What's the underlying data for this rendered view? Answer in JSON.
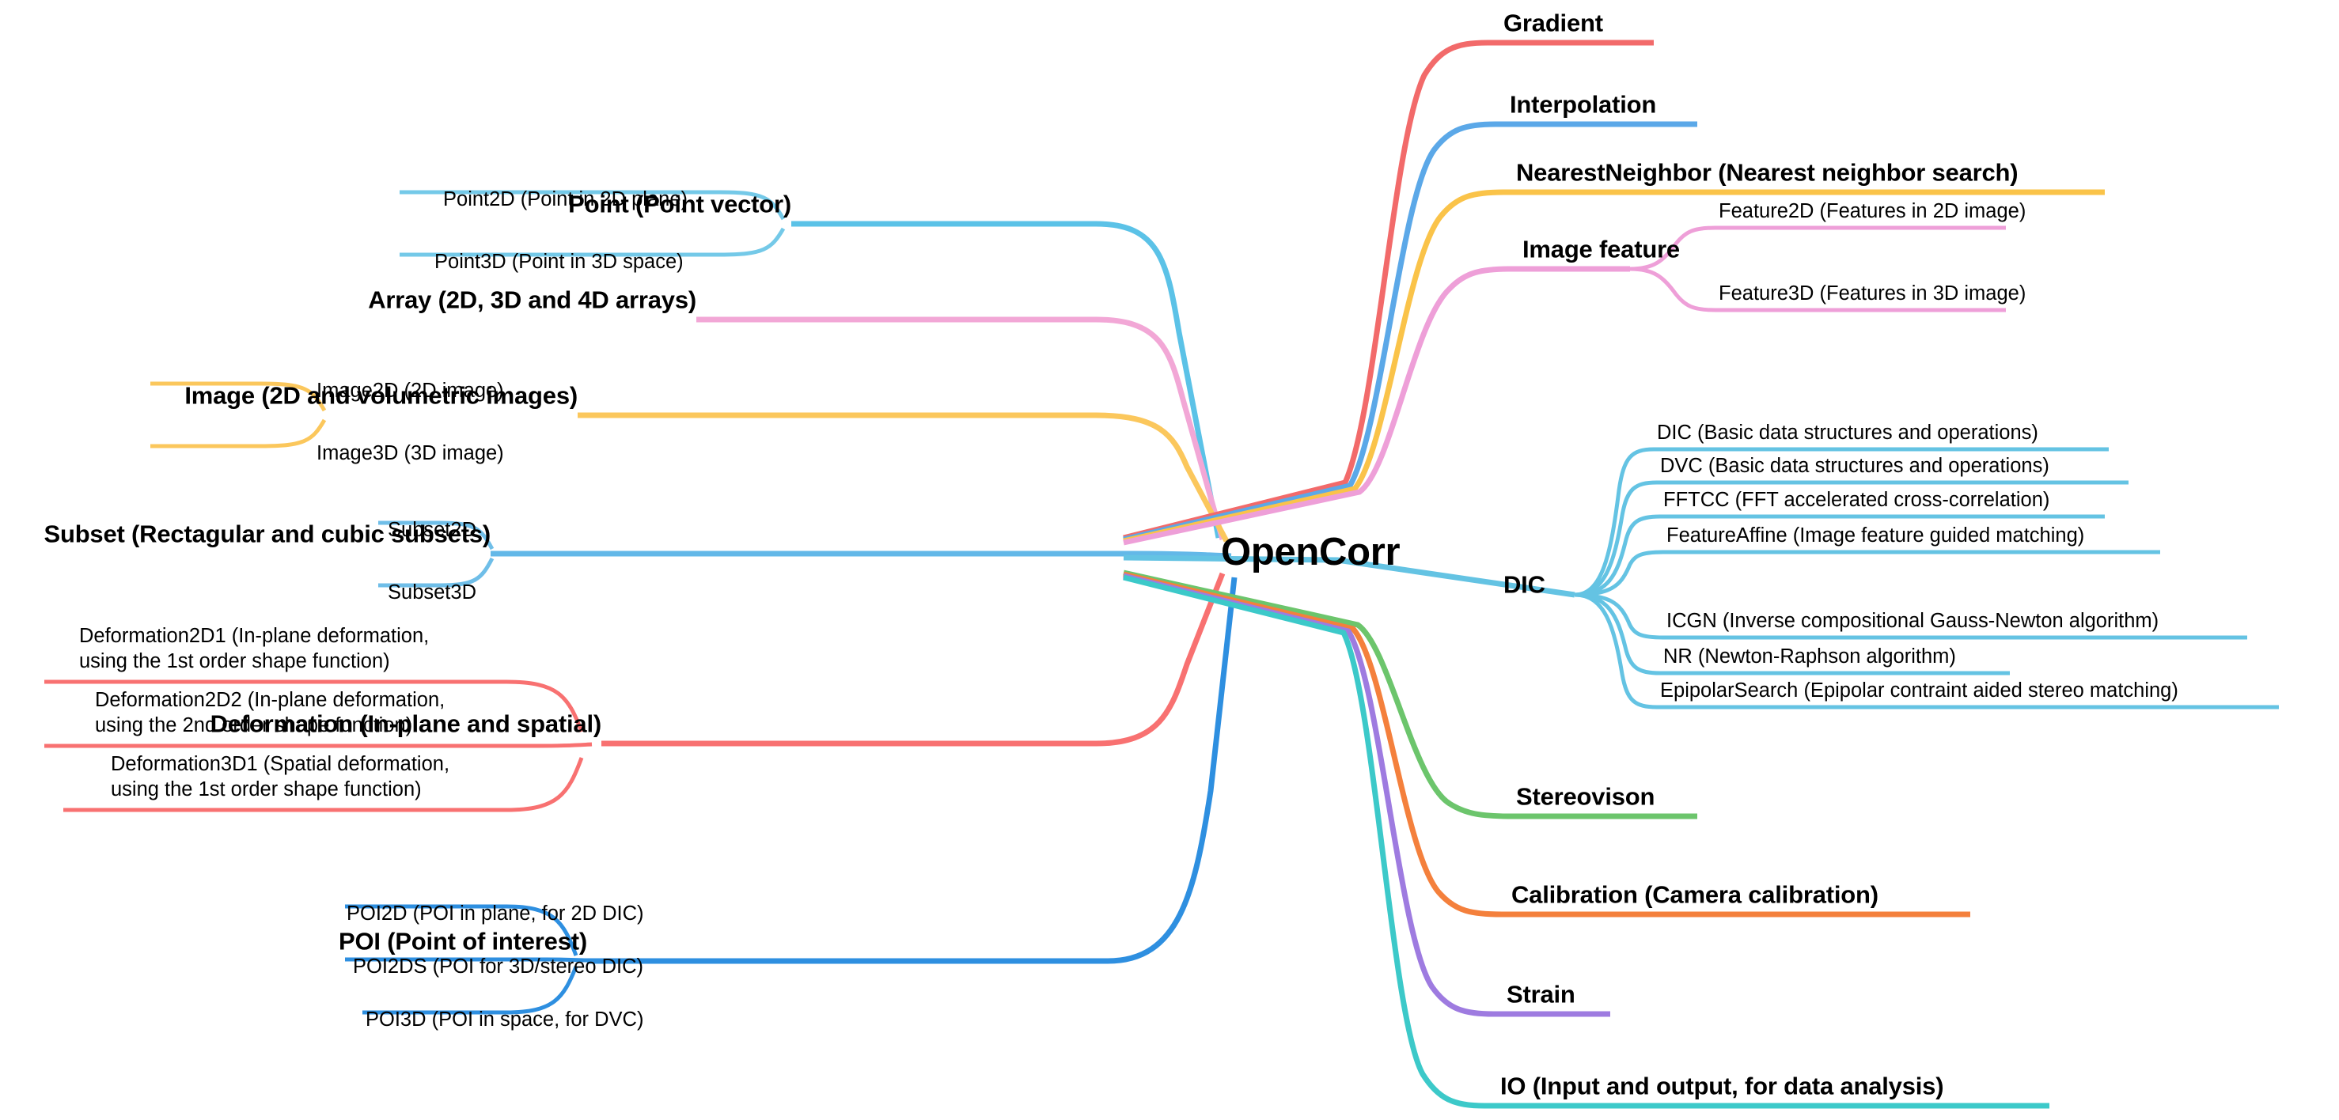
{
  "diagram": {
    "type": "mind-map",
    "title": "OpenCorr",
    "center": {
      "label": "OpenCorr"
    },
    "colors": {
      "point_blue": "#5BC2E7",
      "array_pink": "#F2A7D6",
      "image_yellow": "#FBC75C",
      "subset_blue": "#63B8E8",
      "deformation_red": "#F87171",
      "poi_blue": "#2E8FE0",
      "gradient_red": "#F26A6A",
      "interpolation_blue": "#5BA8E8",
      "nearest_yellow": "#FAC349",
      "feature_pink": "#EE9FD8",
      "dic_blue": "#64C3E3",
      "stereo_green": "#6CC56C",
      "calibration_orange": "#F4803C",
      "strain_purple": "#9E7BE0",
      "io_teal": "#3CC9C9"
    },
    "left_branches": [
      {
        "label": "Point (Point vector)",
        "color": "#5BC2E7",
        "children": [
          {
            "label": "Point2D (Point in 2D plane)"
          },
          {
            "label": "Point3D (Point in 3D space)"
          }
        ]
      },
      {
        "label": "Array (2D, 3D and 4D arrays)",
        "color": "#F2A7D6",
        "children": []
      },
      {
        "label": "Image (2D and volumetric images)",
        "color": "#FBC75C",
        "children": [
          {
            "label": "Image2D (2D image)"
          },
          {
            "label": "Image3D (3D image)"
          }
        ]
      },
      {
        "label": "Subset (Rectagular and cubic subsets)",
        "color": "#63B8E8",
        "children": [
          {
            "label": "Subset2D"
          },
          {
            "label": "Subset3D"
          }
        ]
      },
      {
        "label": "Deformation (In-plane and spatial)",
        "color": "#F87171",
        "children": [
          {
            "line1": "Deformation2D1 (In-plane deformation,",
            "line2": "using the 1st order shape function)"
          },
          {
            "line1": "Deformation2D2 (In-plane deformation,",
            "line2": "using the 2nd order shape function)"
          },
          {
            "line1": "Deformation3D1 (Spatial deformation,",
            "line2": "using the 1st order shape function)"
          }
        ]
      },
      {
        "label": "POI (Point of interest)",
        "color": "#2E8FE0",
        "children": [
          {
            "label": "POI2D (POI in plane, for 2D DIC)"
          },
          {
            "label": "POI2DS (POI for 3D/stereo DIC)"
          },
          {
            "label": "POI3D (POI in space, for DVC)"
          }
        ]
      }
    ],
    "right_branches": [
      {
        "label": "Gradient",
        "color": "#F26A6A",
        "children": []
      },
      {
        "label": "Interpolation",
        "color": "#5BA8E8",
        "children": []
      },
      {
        "label": "NearestNeighbor (Nearest neighbor search)",
        "color": "#FAC349",
        "children": []
      },
      {
        "label": "Image feature",
        "color": "#EE9FD8",
        "children": [
          {
            "label": "Feature2D (Features in 2D image)"
          },
          {
            "label": "Feature3D (Features in 3D image)"
          }
        ]
      },
      {
        "label": "DIC",
        "color": "#64C3E3",
        "children": [
          {
            "label": "DIC (Basic data structures and operations)"
          },
          {
            "label": "DVC (Basic data structures and operations)"
          },
          {
            "label": "FFTCC (FFT accelerated cross-correlation)"
          },
          {
            "label": "FeatureAffine (Image feature guided matching)"
          },
          {
            "label": "ICGN (Inverse compositional Gauss-Newton algorithm)"
          },
          {
            "label": "NR (Newton-Raphson algorithm)"
          },
          {
            "label": "EpipolarSearch (Epipolar contraint aided stereo matching)"
          }
        ]
      },
      {
        "label": "Stereovison",
        "color": "#6CC56C",
        "children": []
      },
      {
        "label": "Calibration (Camera calibration)",
        "color": "#F4803C",
        "children": []
      },
      {
        "label": "Strain",
        "color": "#9E7BE0",
        "children": []
      },
      {
        "label": "IO (Input and output, for data analysis)",
        "color": "#3CC9C9",
        "children": []
      }
    ]
  }
}
